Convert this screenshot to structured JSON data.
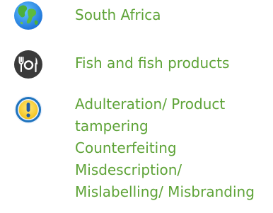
{
  "country": {
    "label": "South Africa",
    "icon": "globe-icon"
  },
  "product": {
    "label": "Fish and fish products",
    "icon": "utensils-icon"
  },
  "hazard": {
    "icon": "exclamation-icon",
    "lines": [
      "Adulteration/ Product",
      "tampering",
      "Counterfeiting",
      "Misdescription/",
      "Mislabelling/ Misbranding"
    ]
  },
  "colors": {
    "label_text": "#5ea337",
    "utensils_bg": "#3a3a3a",
    "exclamation_ring": "#1e73be"
  }
}
